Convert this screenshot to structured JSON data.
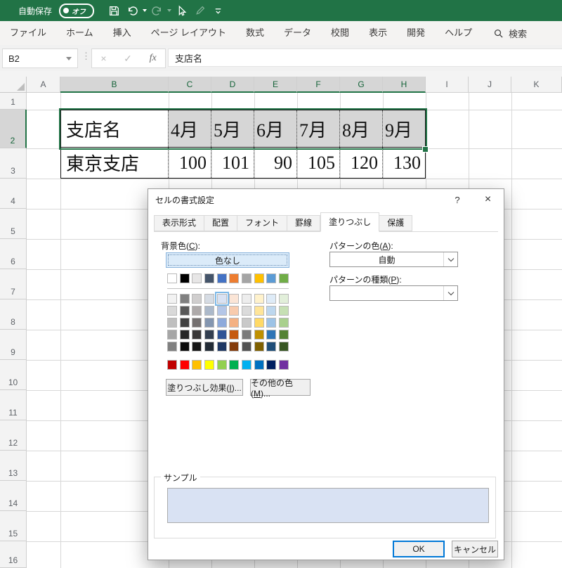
{
  "titlebar": {
    "bg_color": "#217346",
    "autosave_label": "自動保存",
    "autosave_state": "オフ"
  },
  "ribbon": {
    "tabs": [
      "ファイル",
      "ホーム",
      "挿入",
      "ページ レイアウト",
      "数式",
      "データ",
      "校閲",
      "表示",
      "開発",
      "ヘルプ"
    ],
    "search_label": "検索"
  },
  "formula_bar": {
    "name_box_value": "B2",
    "cancel_glyph": "×",
    "enter_glyph": "✓",
    "fx_glyph": "fx",
    "value": "支店名"
  },
  "sheet": {
    "column_headers": [
      "A",
      "B",
      "C",
      "D",
      "E",
      "F",
      "G",
      "H",
      "I",
      "J",
      "K"
    ],
    "selected_columns": [
      "B",
      "C",
      "D",
      "E",
      "F",
      "G",
      "H"
    ],
    "row_headers": [
      "1",
      "2",
      "3",
      "4",
      "5",
      "6",
      "7",
      "8",
      "9",
      "10",
      "11",
      "12",
      "13",
      "14",
      "15",
      "16"
    ],
    "selected_rows": [
      "2"
    ],
    "selection_color": "#217346",
    "selected_cell_fill": "#d6d6d6",
    "table": {
      "header_row": [
        "支店名",
        "4月",
        "5月",
        "6月",
        "7月",
        "8月",
        "9月"
      ],
      "data_row": [
        "東京支店",
        "100",
        "101",
        "90",
        "105",
        "120",
        "130"
      ]
    }
  },
  "dialog": {
    "title": "セルの書式設定",
    "help_glyph": "?",
    "close_glyph": "×",
    "tabs": [
      "表示形式",
      "配置",
      "フォント",
      "罫線",
      "塗りつぶし",
      "保護"
    ],
    "active_tab": "塗りつぶし",
    "background_color_label": {
      "pre": "背景色(",
      "key": "C",
      "post": "):"
    },
    "no_fill_label": "色なし",
    "pattern_color_label": {
      "pre": "パターンの色(",
      "key": "A",
      "post": "):"
    },
    "pattern_color_value": "自動",
    "pattern_type_label": {
      "pre": "パターンの種類(",
      "key": "P",
      "post": "):"
    },
    "fill_effects_label": {
      "pre": "塗りつぶし効果(",
      "key": "I",
      "post": ")..."
    },
    "more_colors_label": {
      "pre": "その他の色(",
      "key": "M",
      "post": ")..."
    },
    "sample_label": "サンプル",
    "sample_fill": "#D9E2F3",
    "ok_label": "OK",
    "cancel_label": "キャンセル",
    "palette": {
      "theme_colors": [
        "#FFFFFF",
        "#000000",
        "#E7E6E6",
        "#44546A",
        "#4472C4",
        "#ED7D31",
        "#A5A5A5",
        "#FFC000",
        "#5B9BD5",
        "#70AD47"
      ],
      "variant_rows": [
        [
          "#F2F2F2",
          "#808080",
          "#D0CECE",
          "#D6DCE4",
          "#D9E2F3",
          "#FBE5D6",
          "#EDEDED",
          "#FFF2CC",
          "#DEEBF7",
          "#E2EFDA"
        ],
        [
          "#D9D9D9",
          "#595959",
          "#AEAAAA",
          "#ACB9CA",
          "#B4C6E7",
          "#F8CBAD",
          "#DBDBDB",
          "#FFE599",
          "#BDD7EE",
          "#C6E0B4"
        ],
        [
          "#BFBFBF",
          "#404040",
          "#757171",
          "#8496B0",
          "#8EAADB",
          "#F4B183",
          "#C9C9C9",
          "#FFD966",
          "#9DC3E6",
          "#A9D08E"
        ],
        [
          "#A6A6A6",
          "#262626",
          "#3A3838",
          "#333F50",
          "#2F5496",
          "#C55A11",
          "#7B7B7B",
          "#BF9000",
          "#2E75B6",
          "#548235"
        ],
        [
          "#808080",
          "#0D0D0D",
          "#161616",
          "#222B35",
          "#1F3864",
          "#843C0C",
          "#525252",
          "#7F6000",
          "#1F4E79",
          "#375623"
        ]
      ],
      "standard_colors": [
        "#C00000",
        "#FF0000",
        "#FFC000",
        "#FFFF00",
        "#92D050",
        "#00B050",
        "#00B0F0",
        "#0070C0",
        "#002060",
        "#7030A0"
      ],
      "selected_swatch": {
        "group": "variants",
        "row": 0,
        "col": 4,
        "color": "#D9E2F3"
      }
    }
  }
}
